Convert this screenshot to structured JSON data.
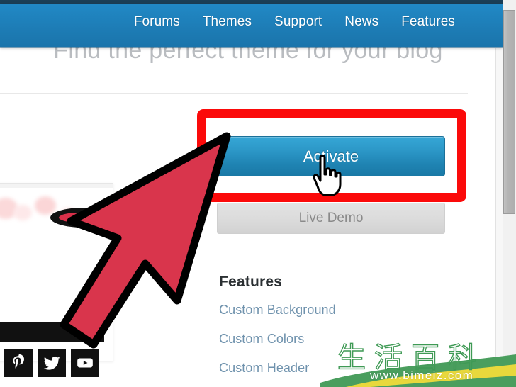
{
  "window": {
    "scrollbar": {
      "name": "vertical-scrollbar",
      "thumb_label": ""
    }
  },
  "navbar": {
    "background_color": "#1e82bf",
    "items": [
      {
        "label": "Forums"
      },
      {
        "label": "Themes"
      },
      {
        "label": "Support"
      },
      {
        "label": "News"
      },
      {
        "label": "Features"
      }
    ]
  },
  "hero": {
    "tagline": "Find the perfect theme for your blog"
  },
  "theme_card": {
    "activate_label": "Activate",
    "live_demo_label": "Live Demo",
    "activate_color": "#2b96c6",
    "highlight_color": "#fb0a0a"
  },
  "features": {
    "heading": "Features",
    "links": [
      {
        "label": "Custom Background"
      },
      {
        "label": "Custom Colors"
      },
      {
        "label": "Custom Header"
      }
    ],
    "link_color": "#6f92ad"
  },
  "social": {
    "icons": [
      {
        "name": "pinterest-icon",
        "glyph": "P"
      },
      {
        "name": "twitter-icon",
        "glyph": "t"
      },
      {
        "name": "youtube-icon",
        "glyph": "y"
      }
    ]
  },
  "annotations": {
    "arrow": {
      "name": "red-pointer-arrow",
      "color": "#d9354c"
    },
    "cursor": {
      "name": "hand-pointer-cursor"
    },
    "highlight_box": {
      "name": "red-highlight-box"
    }
  },
  "watermark": {
    "chinese": "生活百科",
    "url": "www.bimeiz.com",
    "accent_color": "#3f9a55"
  }
}
